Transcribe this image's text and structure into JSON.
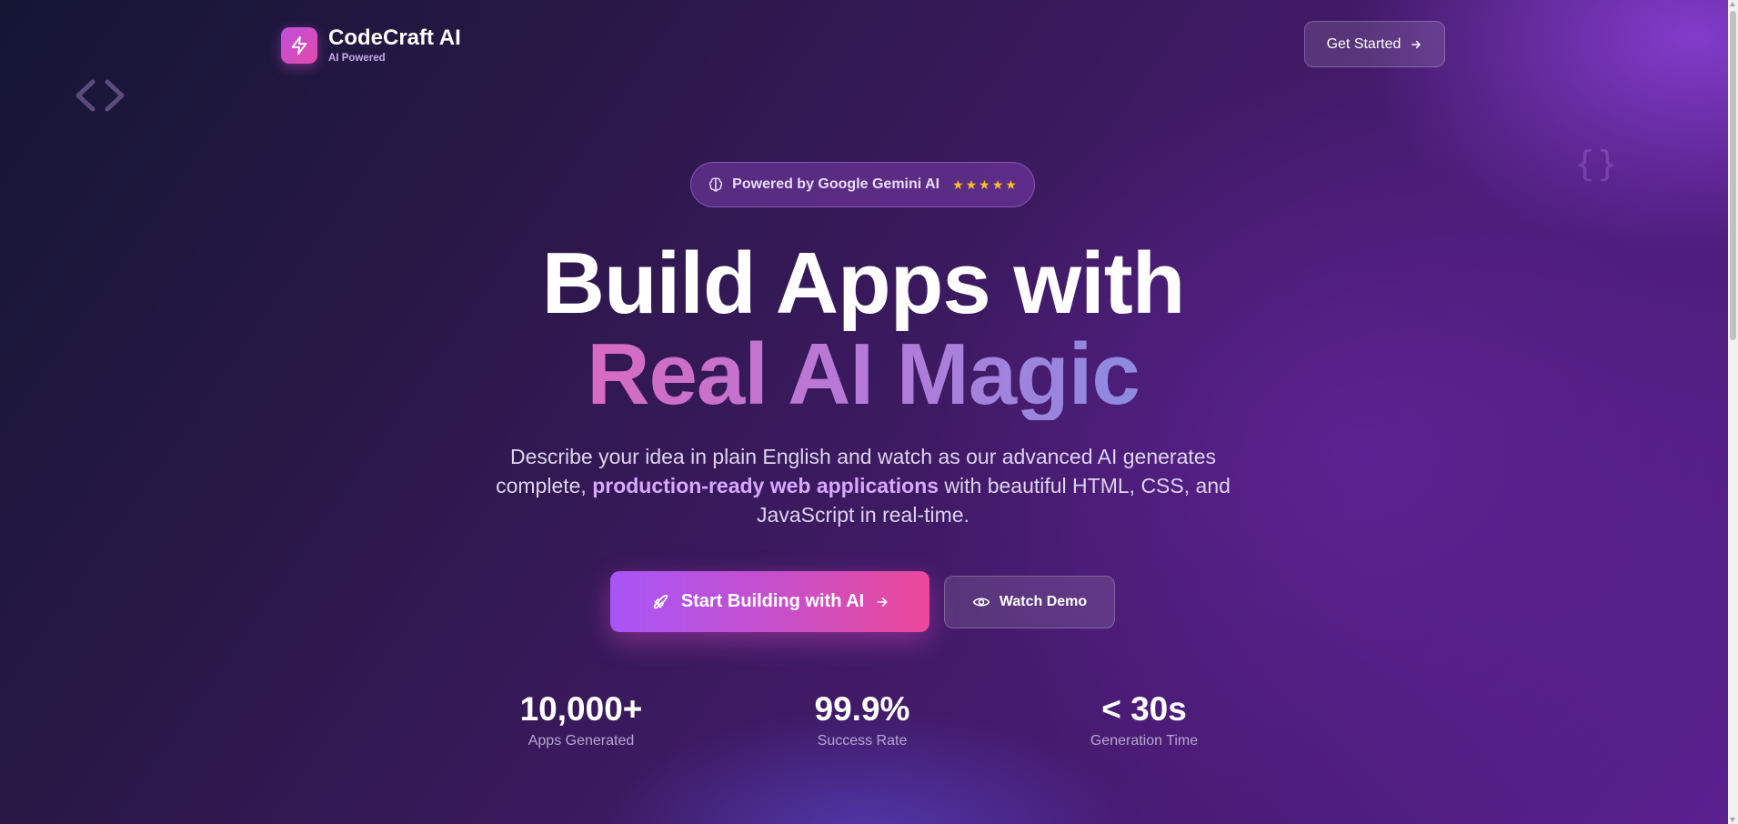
{
  "brand": {
    "name": "CodeCraft AI",
    "tagline": "AI Powered"
  },
  "header": {
    "cta_label": "Get Started"
  },
  "badge": {
    "text": "Powered by Google Gemini AI",
    "stars": "★★★★★"
  },
  "hero": {
    "title_line1": "Build Apps with",
    "title_line2": "Real AI Magic",
    "description_before": "Describe your idea in plain English and watch as our advanced AI generates complete, ",
    "description_highlight": "production-ready web applications",
    "description_after": " with beautiful HTML, CSS, and JavaScript in real-time."
  },
  "actions": {
    "primary_label": "Start Building with AI",
    "secondary_label": "Watch Demo"
  },
  "stats": [
    {
      "value": "10,000+",
      "label": "Apps Generated"
    },
    {
      "value": "99.9%",
      "label": "Success Rate"
    },
    {
      "value": "< 30s",
      "label": "Generation Time"
    }
  ],
  "decor": {
    "code_tag": "<>",
    "braces": "{}"
  },
  "colors": {
    "accent_pink": "#ec4899",
    "accent_purple": "#a855f7",
    "highlight": "#d8a8ff",
    "star": "#fbbf24"
  }
}
